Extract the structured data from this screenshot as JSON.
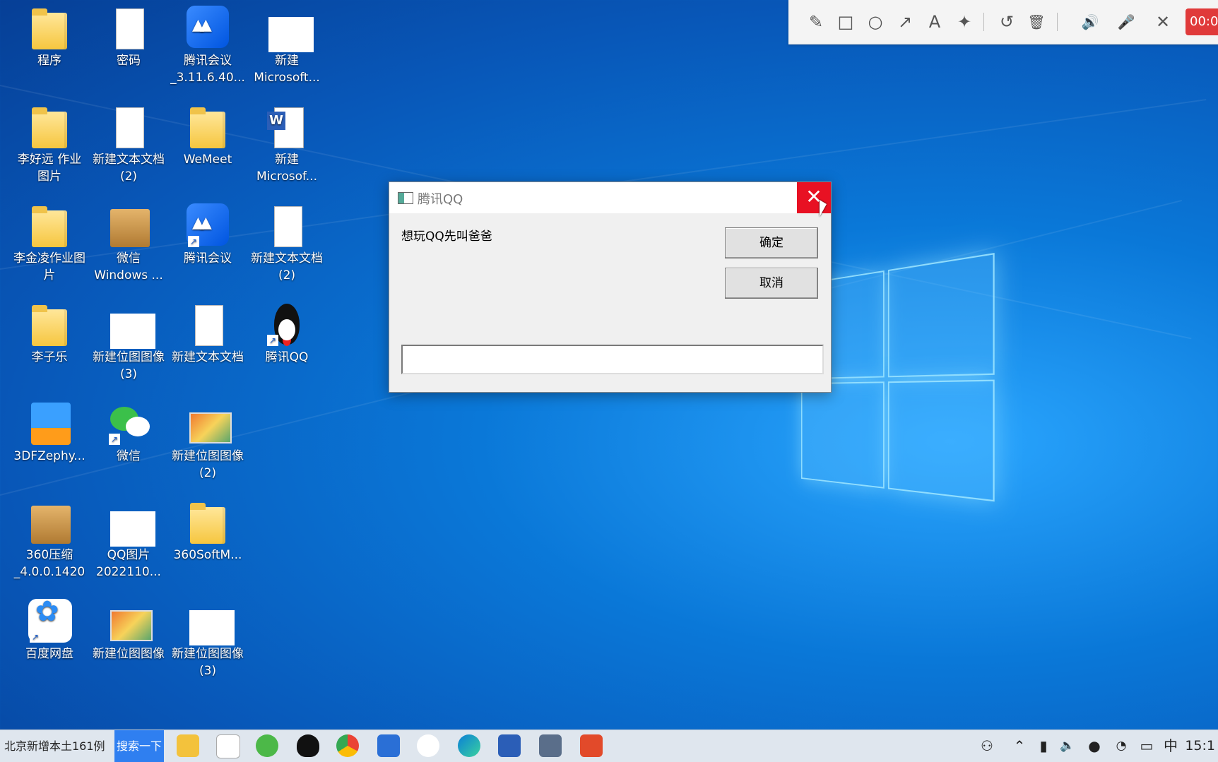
{
  "desktop_icons": [
    {
      "label": "程序",
      "type": "folder"
    },
    {
      "label": "密码",
      "type": "doc"
    },
    {
      "label": "腾讯会议\n_3.11.6.40...",
      "type": "meet"
    },
    {
      "label": "新建\nMicrosoft...",
      "type": "white"
    },
    {
      "label": "李好远 作业\n图片",
      "type": "folder"
    },
    {
      "label": "新建文本文档\n(2)",
      "type": "doc"
    },
    {
      "label": "WeMeet",
      "type": "folder"
    },
    {
      "label": "新建\nMicrosof...",
      "type": "word"
    },
    {
      "label": "李金凌作业图\n片",
      "type": "folder"
    },
    {
      "label": "微信\nWindows ...",
      "type": "box"
    },
    {
      "label": "腾讯会议",
      "type": "meet"
    },
    {
      "label": "新建文本文档\n(2)",
      "type": "doc"
    },
    {
      "label": "李子乐",
      "type": "folder"
    },
    {
      "label": "新建位图图像\n(3)",
      "type": "white"
    },
    {
      "label": "新建文本文档",
      "type": "doc"
    },
    {
      "label": "腾讯QQ",
      "type": "qq"
    },
    {
      "label": "3DFZephy...",
      "type": "zip"
    },
    {
      "label": "微信",
      "type": "wechat"
    },
    {
      "label": "新建位图图像\n(2)",
      "type": "img"
    },
    {
      "label": "360压缩\n_4.0.0.1420",
      "type": "box"
    },
    {
      "label": "QQ图片\n2022110...",
      "type": "white"
    },
    {
      "label": "360SoftM...",
      "type": "folder"
    },
    {
      "label": "百度网盘",
      "type": "baidu"
    },
    {
      "label": "新建位图图像",
      "type": "img"
    },
    {
      "label": "新建位图图像\n(3)",
      "type": "white"
    }
  ],
  "toolbar": {
    "pencil": "✎",
    "rect": "□",
    "circle": "○",
    "arrow": "↗",
    "text": "A",
    "magic": "✦",
    "undo": "↺",
    "trash": "🗑",
    "speaker": "🔊",
    "mic": "🎤",
    "close": "✕",
    "record_time": "00:0"
  },
  "dialog": {
    "title": "腾讯QQ",
    "close": "✕",
    "message": "想玩QQ先叫爸爸",
    "ok_label": "确定",
    "cancel_label": "取消",
    "input_value": ""
  },
  "taskbar": {
    "news": "北京新增本土161例",
    "search": "搜索一下",
    "ime": "中",
    "clock": "15:1"
  },
  "colors": {
    "close_red": "#e81123",
    "search_blue": "#2f7ff0",
    "record_red": "#e03a3a"
  }
}
